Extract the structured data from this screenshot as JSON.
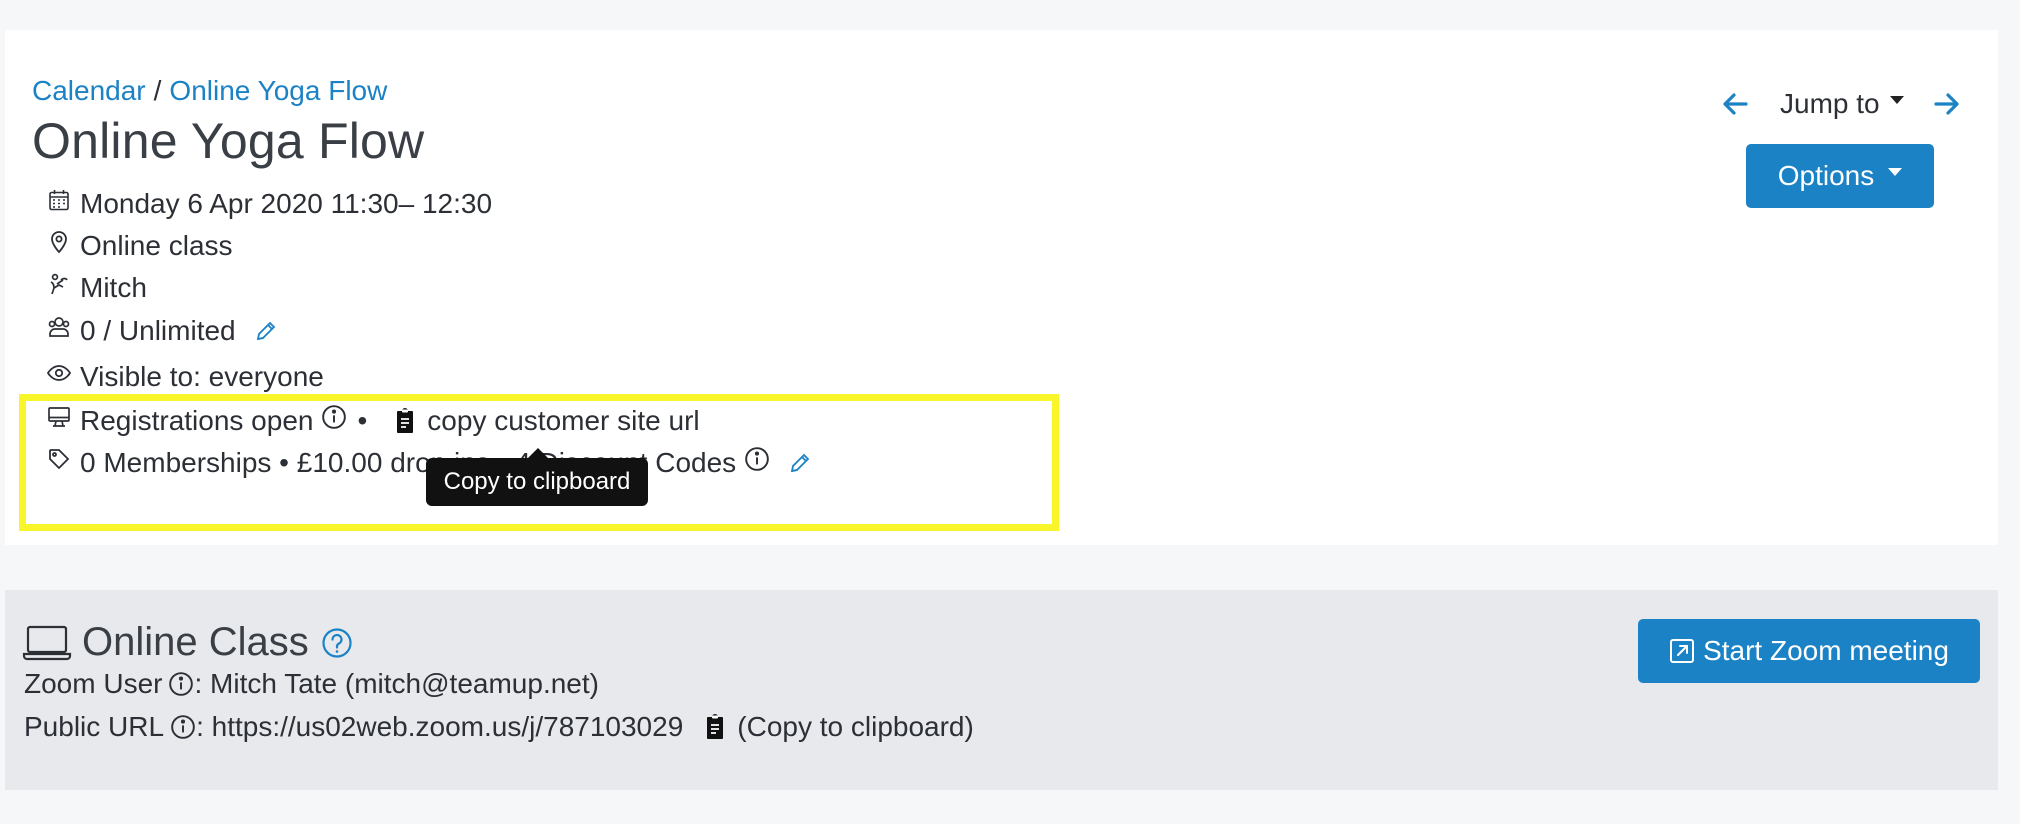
{
  "breadcrumb": {
    "root": "Calendar",
    "separator": "/",
    "current": "Online Yoga Flow"
  },
  "title": "Online Yoga Flow",
  "details": {
    "datetime": "Monday 6 Apr 2020 11:30– 12:30",
    "location": "Online class",
    "instructor": "Mitch",
    "capacity": "0 / Unlimited",
    "visibility": "Visible to: everyone",
    "registrations": "Registrations open",
    "bullet": "•",
    "copy_url": "copy customer site url",
    "pricing": "0 Memberships • £10.00 drop ins • 4 Discount Codes"
  },
  "tooltip": "Copy to clipboard",
  "nav": {
    "jump_to": "Jump to"
  },
  "options_label": "Options",
  "online_class": {
    "title": "Online Class",
    "zoom_user_label": "Zoom User",
    "zoom_user_value": ": Mitch Tate (mitch@teamup.net)",
    "public_url_label": "Public URL",
    "public_url_value": ": https://us02web.zoom.us/j/787103029",
    "copy_label": "(Copy to clipboard)",
    "start_button": "Start Zoom meeting"
  },
  "colors": {
    "accent": "#1b82c5",
    "highlight": "#f8f52b",
    "panel": "#e7e9ed"
  },
  "icons": [
    "calendar-icon",
    "map-pin-icon",
    "instructor-icon",
    "people-icon",
    "eye-icon",
    "monitor-icon",
    "tag-icon",
    "info-icon",
    "clipboard-icon",
    "pencil-icon",
    "arrow-left-icon",
    "arrow-right-icon",
    "laptop-icon",
    "help-icon",
    "external-link-icon"
  ]
}
